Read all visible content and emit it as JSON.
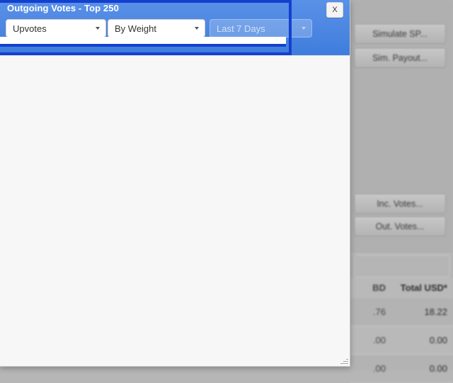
{
  "modal": {
    "title": "Outgoing Votes - Top 250",
    "close_label": "X",
    "filters": {
      "vote_type": {
        "value": "Upvotes",
        "icon": "chevron-down-icon"
      },
      "sort_by": {
        "value": "By Weight",
        "icon": "chevron-down-icon"
      },
      "period": {
        "value": "Last 7 Days",
        "icon": "chevron-down-icon",
        "disabled": true
      }
    },
    "accent_color": "#3f7ddc",
    "focus_color": "#1440cf",
    "body_color": "#f7f7f7"
  },
  "background_app": {
    "buttons": [
      {
        "label": "Simulate SP..."
      },
      {
        "label": "Sim. Payout..."
      },
      {
        "label": "Inc. Votes..."
      },
      {
        "label": "Out. Votes..."
      }
    ],
    "table": {
      "headers": [
        "BD",
        "Total USD*"
      ],
      "rows": [
        [
          ".76",
          "18.22"
        ],
        [
          ".00",
          "0.00"
        ],
        [
          ".00",
          "0.00"
        ]
      ]
    }
  }
}
